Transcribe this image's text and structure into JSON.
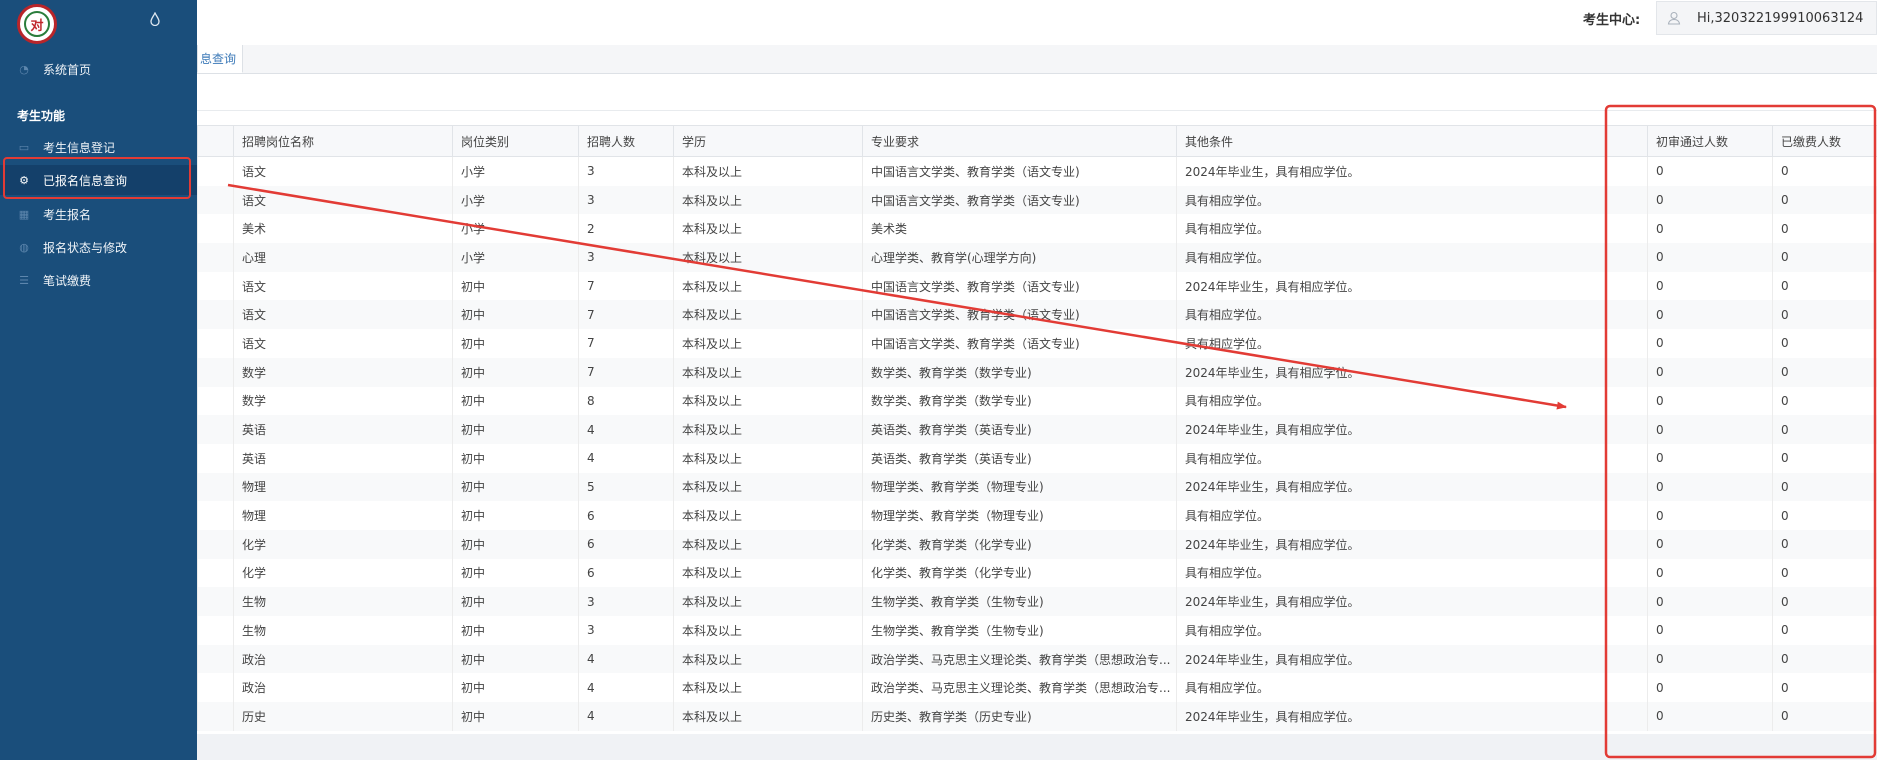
{
  "sidebar": {
    "logo_text": "对",
    "home_label": "系统首页",
    "section_title": "考生功能",
    "items": [
      {
        "label": "考生信息登记",
        "icon": "folder-icon"
      },
      {
        "label": "已报名信息查询",
        "icon": "gear-icon",
        "active": true
      },
      {
        "label": "考生报名",
        "icon": "grid-icon"
      },
      {
        "label": "报名状态与修改",
        "icon": "globe-icon"
      },
      {
        "label": "笔试缴费",
        "icon": "list-icon"
      }
    ]
  },
  "header": {
    "center_label": "考生中心:",
    "user_text": "Hi,320322199910063124"
  },
  "tabs": [
    {
      "label": "息查询"
    }
  ],
  "table": {
    "columns": [
      "招聘岗位名称",
      "岗位类别",
      "招聘人数",
      "学历",
      "专业要求",
      "其他条件",
      "初审通过人数",
      "已缴费人数"
    ],
    "rows": [
      [
        "语文",
        "小学",
        "3",
        "本科及以上",
        "中国语言文学类、教育学类（语文专业)",
        "2024年毕业生，具有相应学位。",
        "0",
        "0"
      ],
      [
        "语文",
        "小学",
        "3",
        "本科及以上",
        "中国语言文学类、教育学类（语文专业)",
        "具有相应学位。",
        "0",
        "0"
      ],
      [
        "美术",
        "小学",
        "2",
        "本科及以上",
        "美术类",
        "具有相应学位。",
        "0",
        "0"
      ],
      [
        "心理",
        "小学",
        "3",
        "本科及以上",
        "心理学类、教育学(心理学方向)",
        "具有相应学位。",
        "0",
        "0"
      ],
      [
        "语文",
        "初中",
        "7",
        "本科及以上",
        "中国语言文学类、教育学类（语文专业)",
        "2024年毕业生，具有相应学位。",
        "0",
        "0"
      ],
      [
        "语文",
        "初中",
        "7",
        "本科及以上",
        "中国语言文学类、教育学类（语文专业)",
        "具有相应学位。",
        "0",
        "0"
      ],
      [
        "语文",
        "初中",
        "7",
        "本科及以上",
        "中国语言文学类、教育学类（语文专业)",
        "具有相应学位。",
        "0",
        "0"
      ],
      [
        "数学",
        "初中",
        "7",
        "本科及以上",
        "数学类、教育学类（数学专业)",
        "2024年毕业生，具有相应学位。",
        "0",
        "0"
      ],
      [
        "数学",
        "初中",
        "8",
        "本科及以上",
        "数学类、教育学类（数学专业)",
        "具有相应学位。",
        "0",
        "0"
      ],
      [
        "英语",
        "初中",
        "4",
        "本科及以上",
        "英语类、教育学类（英语专业)",
        "2024年毕业生，具有相应学位。",
        "0",
        "0"
      ],
      [
        "英语",
        "初中",
        "4",
        "本科及以上",
        "英语类、教育学类（英语专业)",
        "具有相应学位。",
        "0",
        "0"
      ],
      [
        "物理",
        "初中",
        "5",
        "本科及以上",
        "物理学类、教育学类（物理专业)",
        "2024年毕业生，具有相应学位。",
        "0",
        "0"
      ],
      [
        "物理",
        "初中",
        "6",
        "本科及以上",
        "物理学类、教育学类（物理专业)",
        "具有相应学位。",
        "0",
        "0"
      ],
      [
        "化学",
        "初中",
        "6",
        "本科及以上",
        "化学类、教育学类（化学专业)",
        "2024年毕业生，具有相应学位。",
        "0",
        "0"
      ],
      [
        "化学",
        "初中",
        "6",
        "本科及以上",
        "化学类、教育学类（化学专业)",
        "具有相应学位。",
        "0",
        "0"
      ],
      [
        "生物",
        "初中",
        "3",
        "本科及以上",
        "生物学类、教育学类（生物专业)",
        "2024年毕业生，具有相应学位。",
        "0",
        "0"
      ],
      [
        "生物",
        "初中",
        "3",
        "本科及以上",
        "生物学类、教育学类（生物专业)",
        "具有相应学位。",
        "0",
        "0"
      ],
      [
        "政治",
        "初中",
        "4",
        "本科及以上",
        "政治学类、马克思主义理论类、教育学类（思想政治专...",
        "2024年毕业生，具有相应学位。",
        "0",
        "0"
      ],
      [
        "政治",
        "初中",
        "4",
        "本科及以上",
        "政治学类、马克思主义理论类、教育学类（思想政治专...",
        "具有相应学位。",
        "0",
        "0"
      ],
      [
        "历史",
        "初中",
        "4",
        "本科及以上",
        "历史类、教育学类（历史专业)",
        "2024年毕业生，具有相应学位。",
        "0",
        "0"
      ]
    ]
  },
  "colors": {
    "sidebar_bg": "#1a4e7b",
    "annotation_red": "#e23b35",
    "tab_text": "#3d7ab8"
  }
}
